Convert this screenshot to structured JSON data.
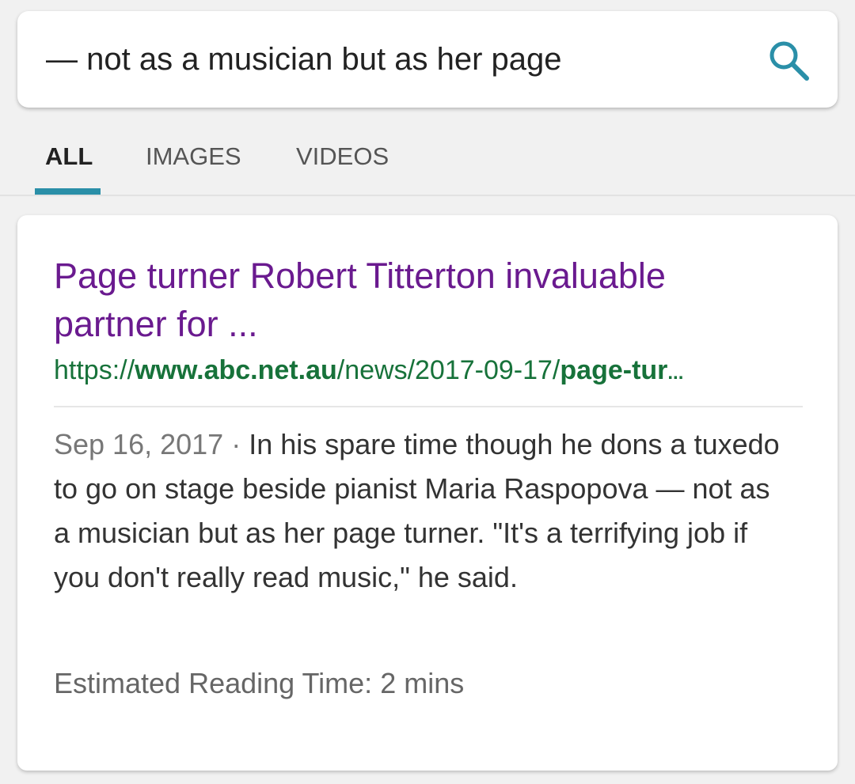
{
  "search": {
    "query": "— not as a musician but as her page",
    "icon": "search-icon",
    "icon_color": "#2a8fa8"
  },
  "tabs": [
    {
      "label": "ALL",
      "active": true
    },
    {
      "label": "IMAGES",
      "active": false
    },
    {
      "label": "VIDEOS",
      "active": false
    }
  ],
  "accent_color": "#2a8fa8",
  "result": {
    "title": "Page turner Robert Titterton invaluable partner for ...",
    "title_color": "#6a1a8f",
    "url": {
      "prefix": "https://",
      "domain": "www.abc.net.au",
      "path": "/news/2017-09-17/",
      "slug": "page-tur",
      "ellipsis": "..."
    },
    "url_color": "#17723a",
    "date": "Sep 16, 2017",
    "separator": " · ",
    "snippet": "In his spare time though he dons a tuxedo to go on stage beside pianist Maria Raspopova — not as a musician but as her page turner. \"It's a terrifying job if you don't really read music,\" he said.",
    "reading_time": "Estimated Reading Time: 2 mins"
  }
}
